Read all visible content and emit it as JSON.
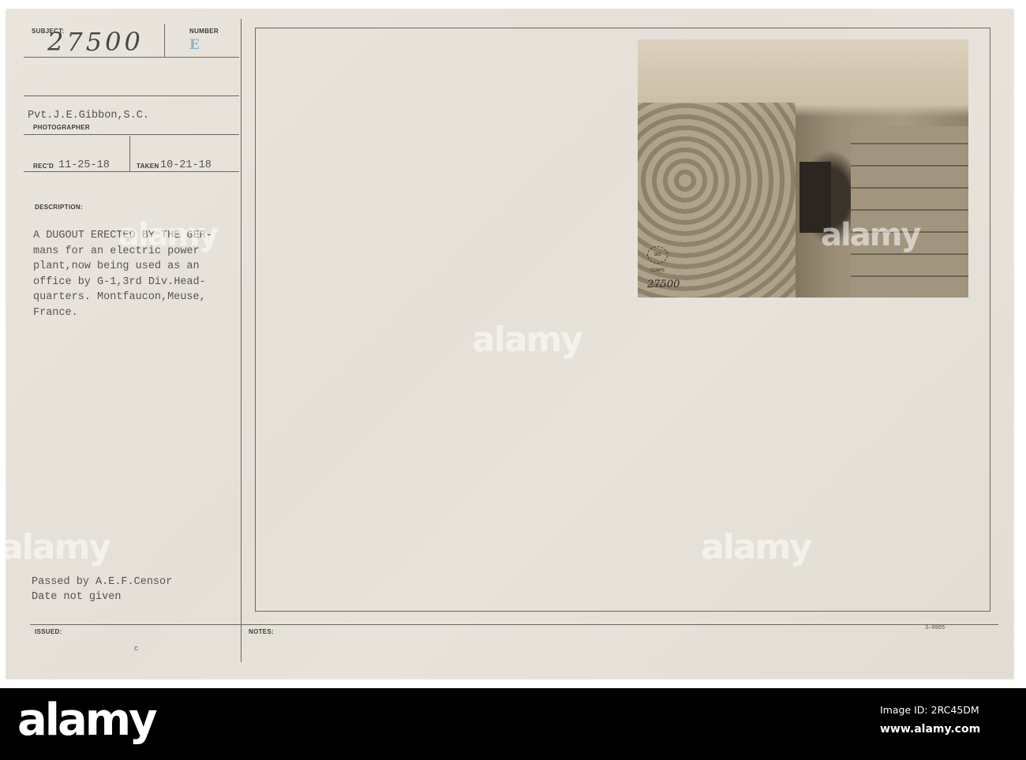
{
  "card": {
    "subject_label": "SUBJECT:",
    "subject_number": "27500",
    "number_label": "NUMBER",
    "number_stamp": "E",
    "photographer_name": "Pvt.J.E.Gibbon,S.C.",
    "photographer_label": "PHOTOGRAPHER",
    "recd_label": "REC'D",
    "recd_date": "11-25-18",
    "taken_label": "TAKEN",
    "taken_date": "10-21-18",
    "description_label": "DESCRIPTION:",
    "description": "A DUGOUT ERECTED BY THE GER-\nmans for an electric power\nplant,now being used as an\noffice by G-1,3rd Div.Head-\nquarters. Montfaucon,Meuse,\nFrance.",
    "censor_line1": "Passed by A.E.F.Censor",
    "censor_line2": "Date not given",
    "issued_label": "ISSUED:",
    "issued_mark": "c",
    "notes_label": "NOTES:",
    "form_number": "3—9005"
  },
  "photo": {
    "inscription": "27500",
    "seal_text": "SIG CORPS U.S.A."
  },
  "watermark": "alamy",
  "footer": {
    "logo": "alamy",
    "image_id": "Image ID: 2RC45DM",
    "site": "www.alamy.com"
  }
}
